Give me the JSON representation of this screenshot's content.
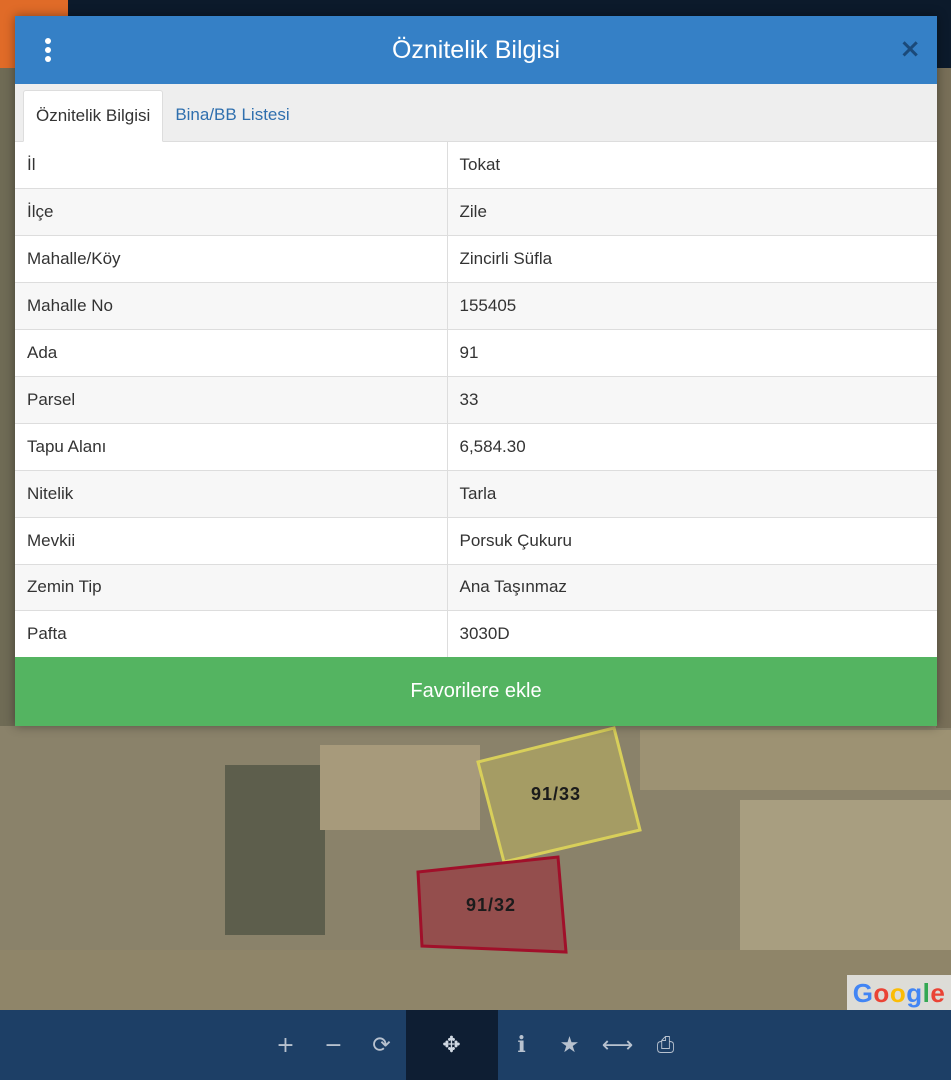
{
  "modal": {
    "title": "Öznitelik Bilgisi",
    "close_icon": "×",
    "tabs": [
      {
        "label": "Öznitelik Bilgisi",
        "active": true
      },
      {
        "label": "Bina/BB Listesi",
        "active": false
      }
    ],
    "rows": [
      {
        "key": "İl",
        "value": "Tokat"
      },
      {
        "key": "İlçe",
        "value": "Zile"
      },
      {
        "key": "Mahalle/Köy",
        "value": "Zincirli Süfla"
      },
      {
        "key": "Mahalle No",
        "value": "155405"
      },
      {
        "key": "Ada",
        "value": "91"
      },
      {
        "key": "Parsel",
        "value": "33"
      },
      {
        "key": "Tapu Alanı",
        "value": "6,584.30"
      },
      {
        "key": "Nitelik",
        "value": "Tarla"
      },
      {
        "key": "Mevkii",
        "value": "Porsuk Çukuru"
      },
      {
        "key": "Zemin Tip",
        "value": "Ana Taşınmaz"
      },
      {
        "key": "Pafta",
        "value": "3030D"
      }
    ],
    "favorite_button": "Favorilere ekle"
  },
  "map": {
    "parcels": [
      {
        "label": "91/33",
        "color": "#d8cf5a"
      },
      {
        "label": "91/32",
        "color": "#a0102a"
      }
    ],
    "attribution": "Google"
  },
  "toolbar": {
    "items": [
      {
        "name": "zoom-in-icon",
        "glyph": "+"
      },
      {
        "name": "zoom-out-icon",
        "glyph": "−"
      },
      {
        "name": "refresh-icon",
        "glyph": "⟳"
      },
      {
        "name": "locate-icon",
        "glyph": "✥",
        "active": true
      },
      {
        "name": "info-icon",
        "glyph": "i"
      },
      {
        "name": "star-icon",
        "glyph": "★"
      },
      {
        "name": "measure-icon",
        "glyph": "⟷"
      },
      {
        "name": "print-icon",
        "glyph": "⎙"
      }
    ]
  },
  "colors": {
    "header": "#3580c6",
    "favorite": "#54b461",
    "toolbar": "#1d3f66"
  }
}
